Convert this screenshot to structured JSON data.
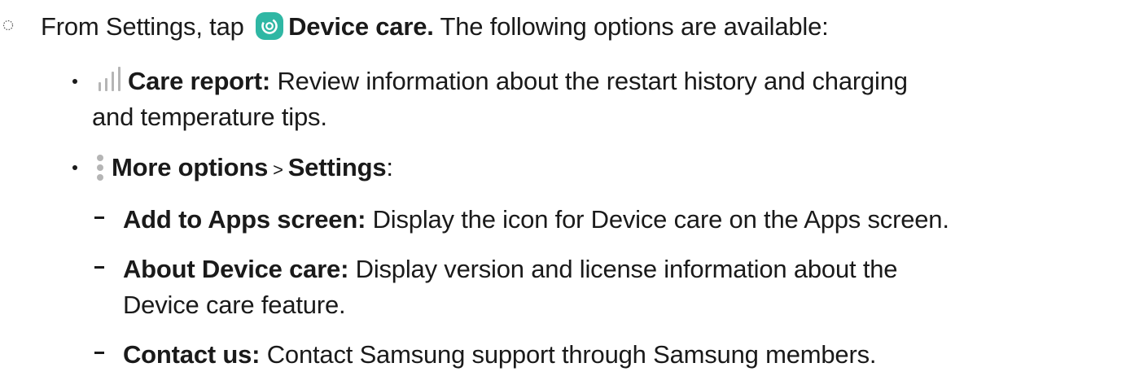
{
  "step": {
    "prefix": "From Settings, tap ",
    "app_name": "Device care.",
    "suffix": " The following options are available:"
  },
  "items": [
    {
      "title": "Care report:",
      "desc_line1": " Review information about the restart history and charging",
      "desc_line2": "and temperature tips."
    },
    {
      "title": "More options",
      "separator": " > ",
      "subtitle": "Settings",
      "colon": ":"
    }
  ],
  "subitems": [
    {
      "title": "Add to Apps screen:",
      "desc_line1": " Display the icon for Device care on the Apps screen."
    },
    {
      "title": "About Device care:",
      "desc_line1": " Display version and license information about the",
      "desc_line2": "Device care feature."
    },
    {
      "title": "Contact us:",
      "desc_line1": " Contact Samsung support through Samsung members."
    }
  ],
  "colors": {
    "text": "#1a1a1a",
    "app_icon": "#2fb7a4",
    "icon_gray": "#b5b5b5"
  },
  "icons": [
    "dotted-circle-step-marker",
    "device-care-icon",
    "care-report-bars-icon",
    "more-options-icon"
  ]
}
